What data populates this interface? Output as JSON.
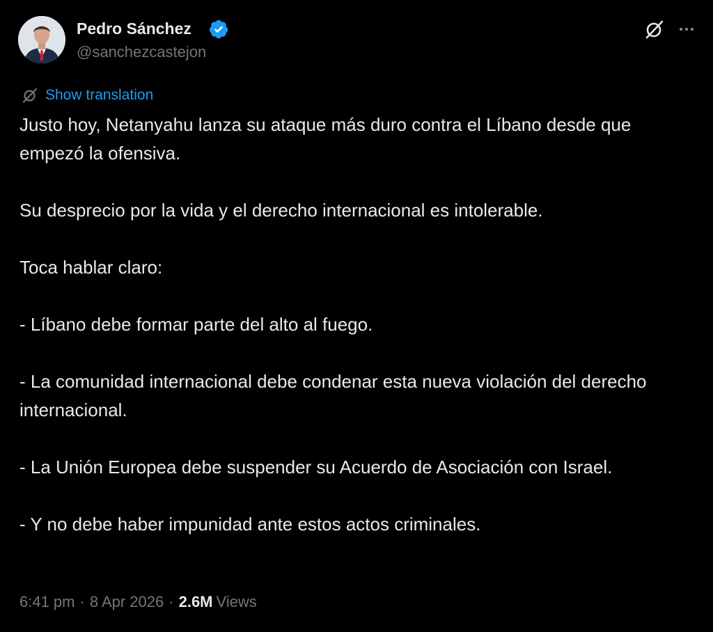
{
  "author": {
    "name": "Pedro Sánchez",
    "handle": "@sanchezcastejon",
    "verified_color": "#1d9bf0"
  },
  "actions": {
    "grok_icon": "grok-icon",
    "more_icon": "more-horizontal-icon"
  },
  "translation": {
    "icon": "translate-icon",
    "label": "Show translation"
  },
  "post": {
    "paragraphs": [
      "Justo hoy, Netanyahu lanza su ataque más duro contra el Líbano desde que empezó la ofensiva.",
      "Su desprecio por la vida y el derecho internacional es intolerable.",
      "Toca hablar claro:",
      "- Líbano debe formar parte del alto al fuego.",
      "- La comunidad internacional debe condenar esta nueva violación del derecho internacional.",
      "- La Unión Europea debe suspender su Acuerdo de Asociación con Israel.",
      "- Y no debe haber impunidad ante estos actos criminales."
    ]
  },
  "meta": {
    "time": "6:41 pm",
    "separator": "·",
    "date": "8 Apr 2026",
    "views_count": "2.6M",
    "views_label": "Views"
  },
  "colors": {
    "background": "#000000",
    "text": "#e7e9ea",
    "muted": "#71767b",
    "link": "#1d9bf0"
  }
}
